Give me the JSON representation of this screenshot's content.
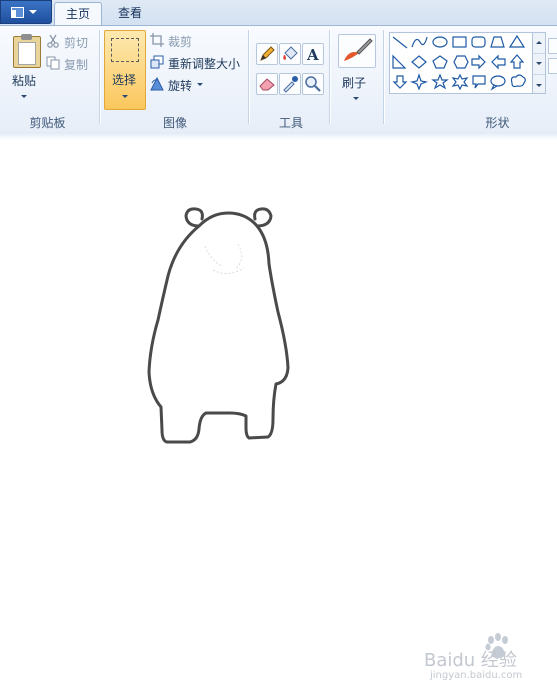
{
  "tabs": {
    "home": "主页",
    "view": "查看"
  },
  "clipboard": {
    "paste": "粘贴",
    "cut": "剪切",
    "copy": "复制",
    "group": "剪贴板"
  },
  "image": {
    "select": "选择",
    "crop": "裁剪",
    "resize": "重新调整大小",
    "rotate": "旋转",
    "group": "图像"
  },
  "tools": {
    "group": "工具",
    "items": [
      "pencil-icon",
      "fill-icon",
      "text-icon",
      "eraser-icon",
      "color-picker-icon",
      "magnifier-icon"
    ]
  },
  "brushes": {
    "label": "刷子"
  },
  "shapes": {
    "group": "形状"
  },
  "watermark": {
    "brand": "Baidu 经验",
    "url": "jingyan.baidu.com"
  },
  "colors": {
    "selected_button": "#fbc75d",
    "outline": "#4a4a4a"
  }
}
